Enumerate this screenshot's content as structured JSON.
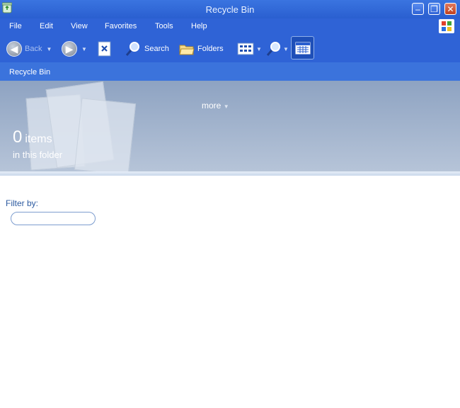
{
  "window": {
    "title": "Recycle Bin"
  },
  "menu": [
    "File",
    "Edit",
    "View",
    "Favorites",
    "Tools",
    "Help"
  ],
  "toolbar": {
    "back_label": "Back",
    "search_label": "Search",
    "folders_label": "Folders"
  },
  "address": {
    "location": "Recycle Bin"
  },
  "banner": {
    "more_label": "more",
    "count": "0",
    "count_unit": "items",
    "subtitle": "in this folder"
  },
  "filter": {
    "label": "Filter by:",
    "value": ""
  },
  "colors": {
    "title_bar": "#2a5fd0",
    "toolbar": "#2f63d6",
    "banner": "#8ea3c2",
    "filter_label": "#2c5aa0"
  }
}
